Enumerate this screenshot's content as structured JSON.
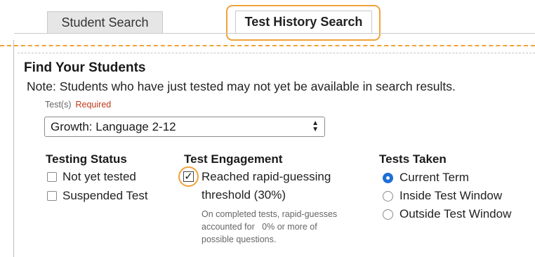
{
  "tabs": {
    "student_search": "Student Search",
    "test_history_search": "Test History Search"
  },
  "find": {
    "title": "Find Your Students",
    "note": "Note: Students who have just tested may not yet be available in search results."
  },
  "test_select": {
    "label": "Test(s)",
    "required": "Required",
    "value": "Growth: Language 2-12"
  },
  "testing_status": {
    "heading": "Testing Status",
    "options": [
      {
        "label": "Not yet tested",
        "checked": false
      },
      {
        "label": "Suspended Test",
        "checked": false
      }
    ]
  },
  "engagement": {
    "heading": "Test Engagement",
    "option_line1": "Reached rapid-guessing",
    "option_line2": "threshold (30%)",
    "checked": true,
    "desc_line1": "On completed tests, rapid-guesses",
    "desc_line2": "accounted for   0% or more of",
    "desc_line3": "possible questions."
  },
  "tests_taken": {
    "heading": "Tests Taken",
    "options": [
      {
        "label": "Current Term",
        "selected": true
      },
      {
        "label": "Inside Test Window",
        "selected": false
      },
      {
        "label": "Outside Test Window",
        "selected": false
      }
    ]
  },
  "colors": {
    "highlight": "#f0a33a",
    "required": "#c0391b",
    "radio_selected": "#1e6fd6"
  }
}
